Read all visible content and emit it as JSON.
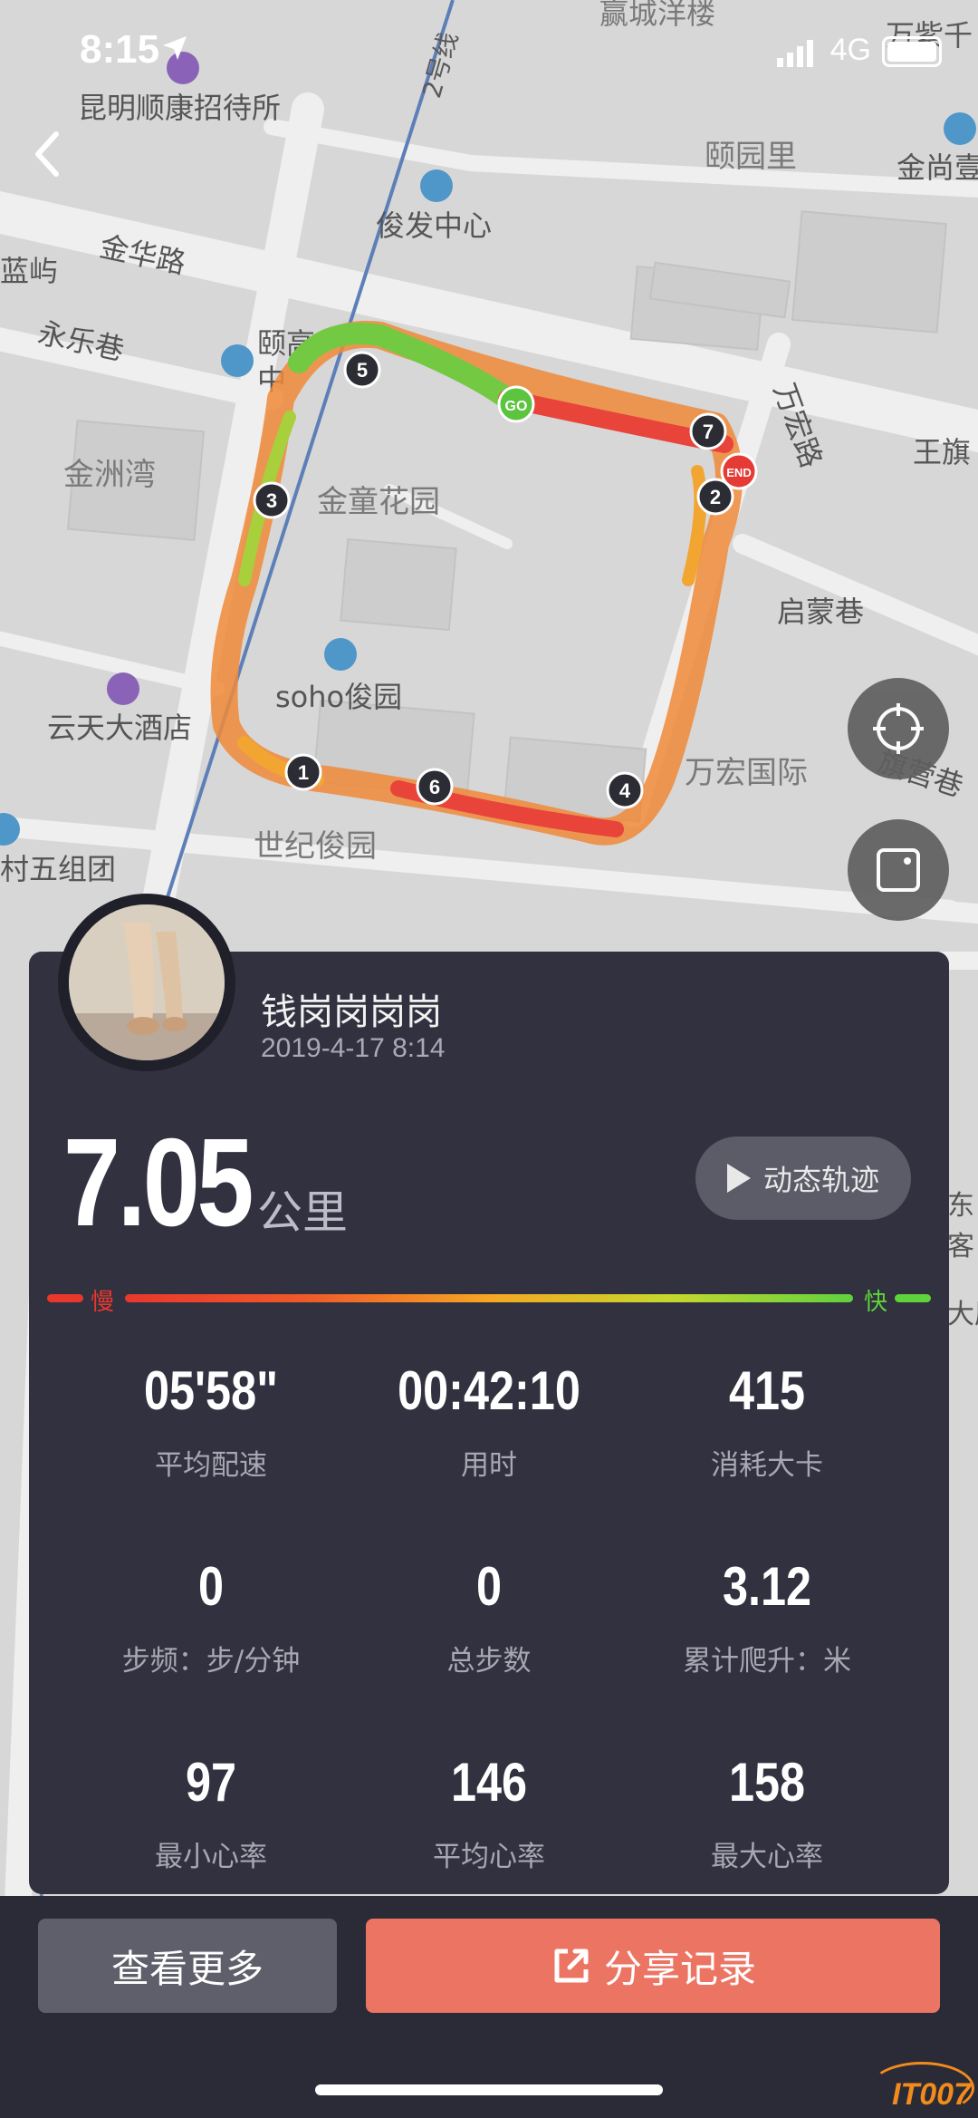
{
  "status_bar": {
    "time": "8:15",
    "network": "4G"
  },
  "map": {
    "labels": [
      "赢城洋楼",
      "万紫千",
      "昆明顺康招待所",
      "2号线",
      "颐园里",
      "金尚壹",
      "俊发中心",
      "蓝屿",
      "金华路",
      "永乐巷",
      "颐高",
      "中",
      "万宏路",
      "王旗",
      "金洲湾",
      "金童花园",
      "启蒙巷",
      "soho俊园",
      "云天大酒店",
      "万宏国际",
      "旗营巷",
      "村五组团",
      "世纪俊园",
      "东",
      "客",
      "大厦"
    ],
    "start_marker": "GO",
    "end_marker": "END",
    "km_markers": [
      "1",
      "2",
      "3",
      "4",
      "5",
      "6",
      "7"
    ]
  },
  "user": {
    "name": "钱岗岗岗岗",
    "date": "2019-4-17 8:14"
  },
  "distance": {
    "value": "7.05",
    "unit": "公里"
  },
  "replay_button": {
    "label": "动态轨迹"
  },
  "speed_legend": {
    "slow": "慢",
    "fast": "快",
    "slow_color": "#e8382d",
    "fast_color": "#5fd23c"
  },
  "stats": [
    {
      "value": "05'58\"",
      "label": "平均配速"
    },
    {
      "value": "00:42:10",
      "label": "用时"
    },
    {
      "value": "415",
      "label": "消耗大卡"
    },
    {
      "value": "0",
      "label": "步频：步/分钟"
    },
    {
      "value": "0",
      "label": "总步数"
    },
    {
      "value": "3.12",
      "label": "累计爬升：米"
    },
    {
      "value": "97",
      "label": "最小心率"
    },
    {
      "value": "146",
      "label": "平均心率"
    },
    {
      "value": "158",
      "label": "最大心率"
    }
  ],
  "buttons": {
    "more": "查看更多",
    "share": "分享记录"
  },
  "colors": {
    "card": "#31313f",
    "share": "#ec7463",
    "more": "#5f5f6b"
  },
  "watermark": "IT007"
}
